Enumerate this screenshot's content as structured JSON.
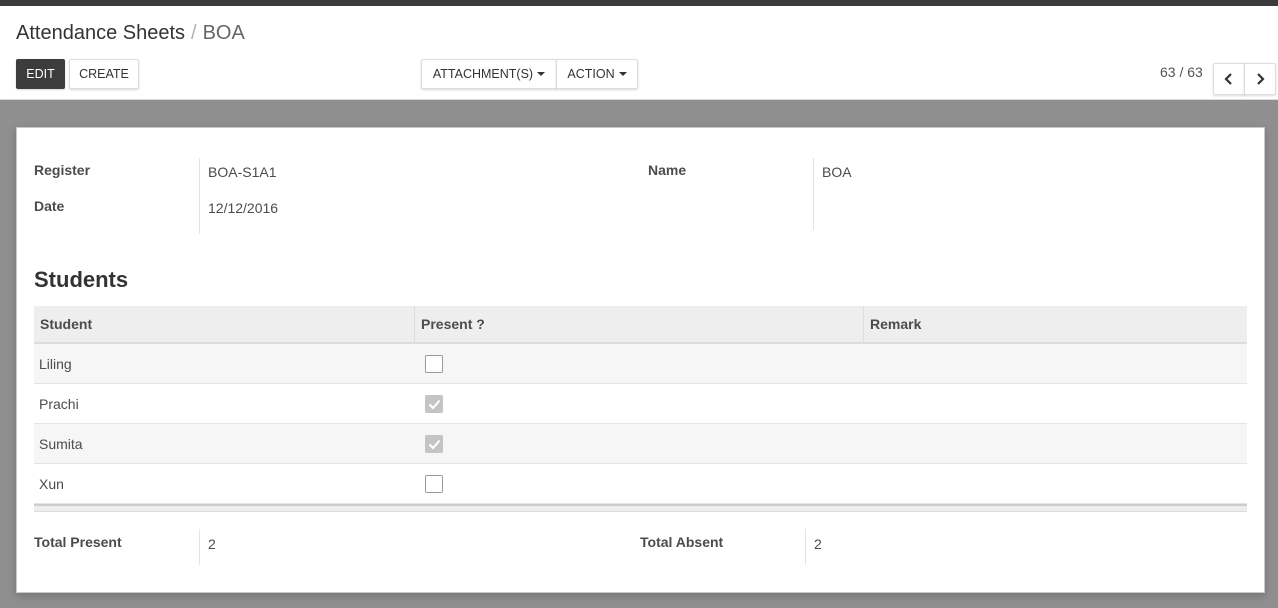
{
  "breadcrumb": {
    "parent": "Attendance Sheets",
    "separator": "/",
    "current": "BOA"
  },
  "toolbar": {
    "edit_label": "EDIT",
    "create_label": "CREATE",
    "attachments_label": "ATTACHMENT(S)",
    "action_label": "ACTION"
  },
  "pager": {
    "value": "63 / 63"
  },
  "form": {
    "register_label": "Register",
    "register_value": "BOA-S1A1",
    "date_label": "Date",
    "date_value": "12/12/2016",
    "name_label": "Name",
    "name_value": "BOA"
  },
  "students": {
    "title": "Students",
    "columns": [
      "Student",
      "Present ?",
      "Remark"
    ],
    "rows": [
      {
        "student": "Liling",
        "present": false,
        "remark": ""
      },
      {
        "student": "Prachi",
        "present": true,
        "remark": ""
      },
      {
        "student": "Sumita",
        "present": true,
        "remark": ""
      },
      {
        "student": "Xun",
        "present": false,
        "remark": ""
      }
    ]
  },
  "totals": {
    "present_label": "Total Present",
    "present_value": "2",
    "absent_label": "Total Absent",
    "absent_value": "2"
  },
  "icons": {
    "prev": "chevron-left-icon",
    "next": "chevron-right-icon",
    "dropdown": "caret-down-icon",
    "check": "check-icon"
  },
  "colors": {
    "primary_button": "#3c3c3c",
    "checked_box": "#c4c4c4"
  }
}
